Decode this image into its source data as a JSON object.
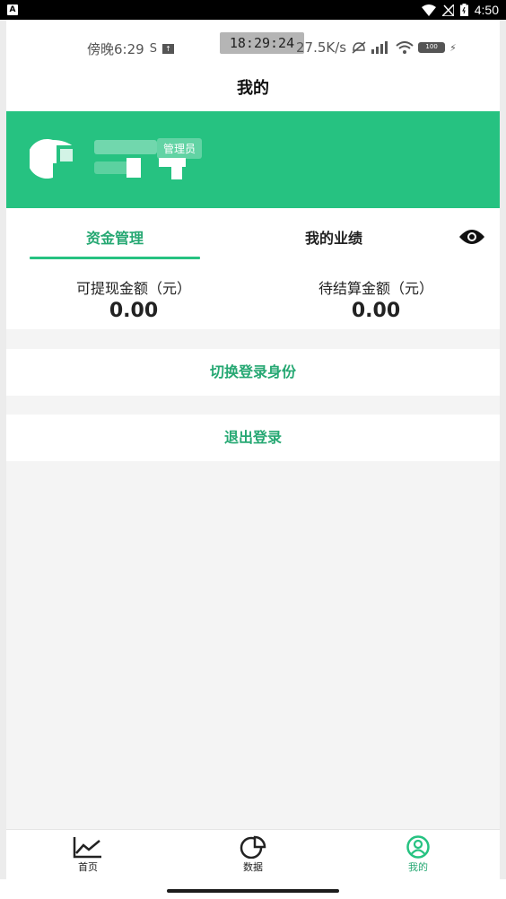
{
  "system_status": {
    "time": "4:50",
    "app_indicator": "A"
  },
  "inner_status": {
    "left_text": "傍晚6:29",
    "clock": "18:29:24",
    "net_speed": "27.5K/s",
    "battery": "100"
  },
  "header": {
    "title": "我的"
  },
  "profile": {
    "role_badge": "管理员",
    "accent_color": "#26c281"
  },
  "funds": {
    "tabs": [
      {
        "label": "资金管理",
        "active": true
      },
      {
        "label": "我的业绩",
        "active": false
      }
    ],
    "withdrawable": {
      "label": "可提现金额（元）",
      "value": "0.00"
    },
    "pending": {
      "label": "待结算金额（元）",
      "value": "0.00"
    }
  },
  "actions": {
    "switch_identity": "切换登录身份",
    "logout": "退出登录"
  },
  "tabbar": {
    "items": [
      {
        "label": "首页",
        "icon": "line-chart-icon",
        "active": false
      },
      {
        "label": "数据",
        "icon": "pie-chart-icon",
        "active": false
      },
      {
        "label": "我的",
        "icon": "user-circle-icon",
        "active": true
      }
    ]
  }
}
